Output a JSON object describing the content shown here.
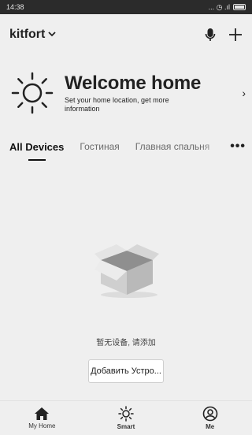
{
  "status": {
    "time": "14:38",
    "icons_text": "... ◷ .ıl"
  },
  "header": {
    "home_name": "kitfort",
    "dropdown_icon": "chevron-down-icon",
    "mic_icon": "microphone-icon",
    "add_icon": "plus-icon"
  },
  "welcome": {
    "title": "Welcome home",
    "subtitle": "Set your home location, get more information",
    "icon": "sun-icon",
    "arrow": "›"
  },
  "tabs": [
    {
      "label": "All Devices",
      "active": true
    },
    {
      "label": "Гостиная",
      "active": false
    },
    {
      "label": "Главная спальня",
      "active": false
    }
  ],
  "more": "•••",
  "empty": {
    "icon": "empty-box-icon",
    "text": "暂无设备, 请添加",
    "button_label": "Добавить Устро..."
  },
  "nav": [
    {
      "label": "My Home",
      "icon": "home-icon"
    },
    {
      "label": "Smart",
      "icon": "sun-icon"
    },
    {
      "label": "Me",
      "icon": "user-icon"
    }
  ],
  "colors": {
    "background": "#efefef",
    "statusbar": "#2b2b2b",
    "text": "#222222"
  }
}
